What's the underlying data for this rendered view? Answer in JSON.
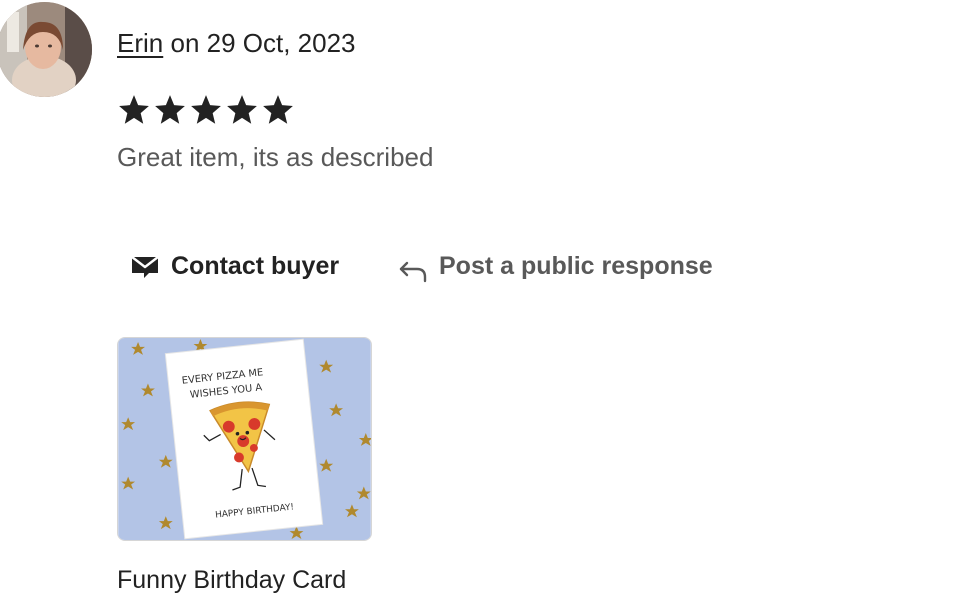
{
  "review": {
    "reviewer_name": "Erin",
    "date_text": "on 29 Oct, 2023",
    "rating": 5,
    "rating_max": 5,
    "text": "Great item, its as described"
  },
  "actions": {
    "contact_label": "Contact buyer",
    "contact_icon": "envelope-icon",
    "respond_label": "Post a public response",
    "respond_icon": "reply-arrow-icon"
  },
  "item": {
    "title": "Funny Birthday Card",
    "card_line1": "EVERY PIZZA ME",
    "card_line2": "WISHES YOU A",
    "card_line3": "HAPPY BIRTHDAY!"
  },
  "colors": {
    "text": "#222222",
    "muted": "#595959",
    "thumb_bg": "#b3c4e6",
    "star_gold": "#b0892e"
  }
}
